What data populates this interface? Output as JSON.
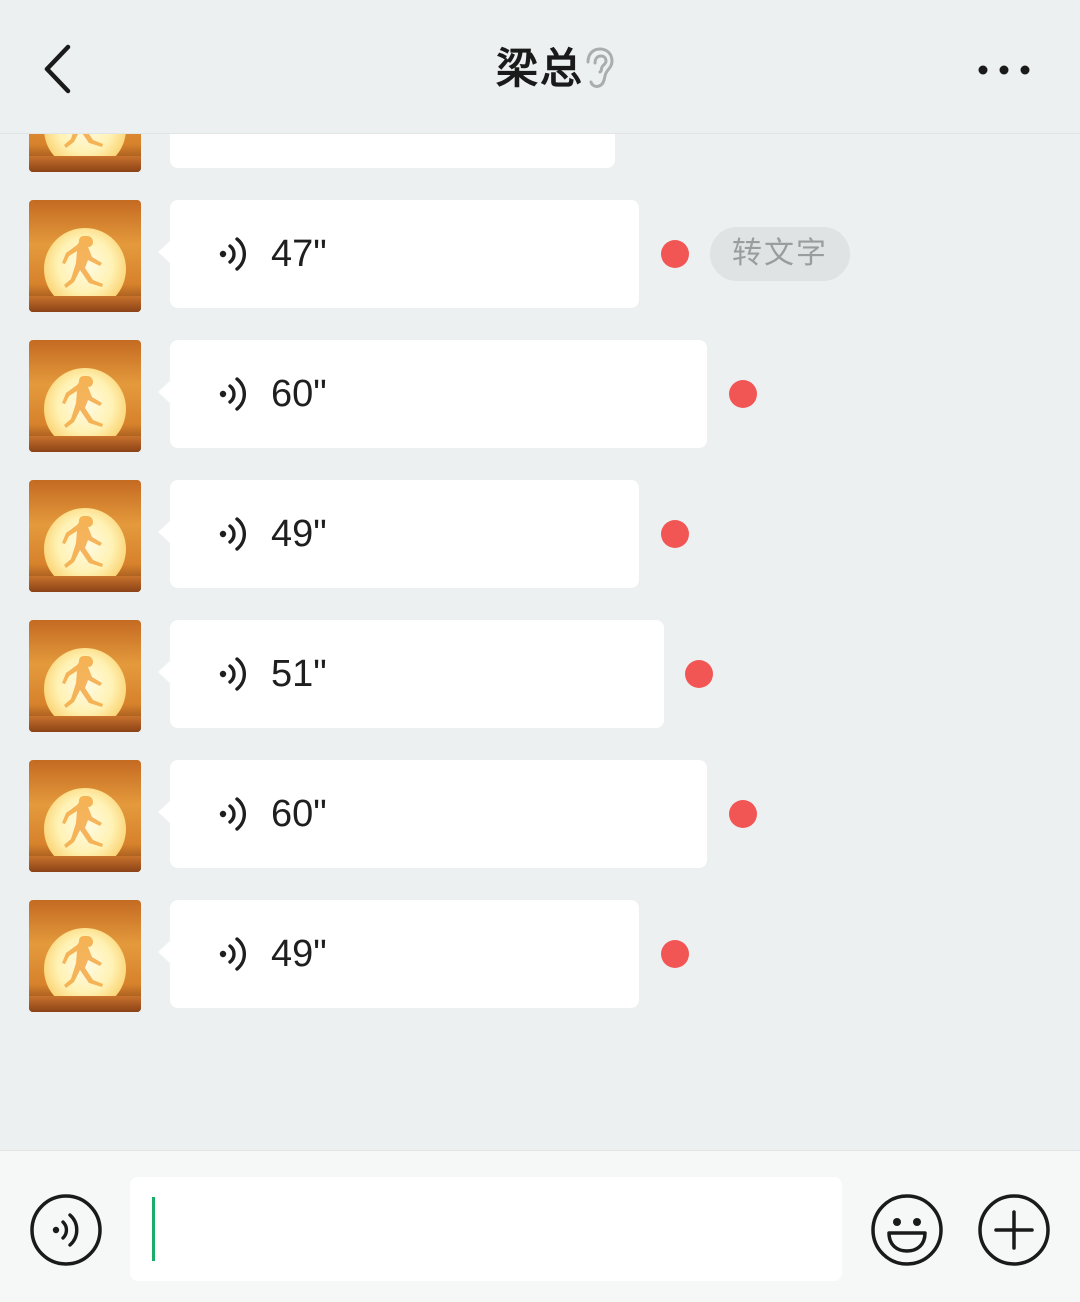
{
  "header": {
    "title": "梁总",
    "back_icon": "chevron-left-icon",
    "earpiece_icon": "ear-icon",
    "more_icon": "more-dots-icon"
  },
  "messages": [
    {
      "type": "voice",
      "duration": "",
      "unread": false,
      "partial": true
    },
    {
      "type": "voice",
      "duration": "47\"",
      "unread": true,
      "transcribe_label": "转文字"
    },
    {
      "type": "voice",
      "duration": "60\"",
      "unread": true
    },
    {
      "type": "voice",
      "duration": "49\"",
      "unread": true
    },
    {
      "type": "voice",
      "duration": "51\"",
      "unread": true
    },
    {
      "type": "voice",
      "duration": "60\"",
      "unread": true
    },
    {
      "type": "voice",
      "duration": "49\"",
      "unread": true
    }
  ],
  "input_bar": {
    "voice_icon": "voice-mode-icon",
    "input_value": "",
    "emoji_icon": "emoji-icon",
    "plus_icon": "plus-icon"
  },
  "colors": {
    "background": "#edf0f0",
    "bubble": "#ffffff",
    "unread_dot": "#f25654",
    "caret": "#1aad6a"
  }
}
